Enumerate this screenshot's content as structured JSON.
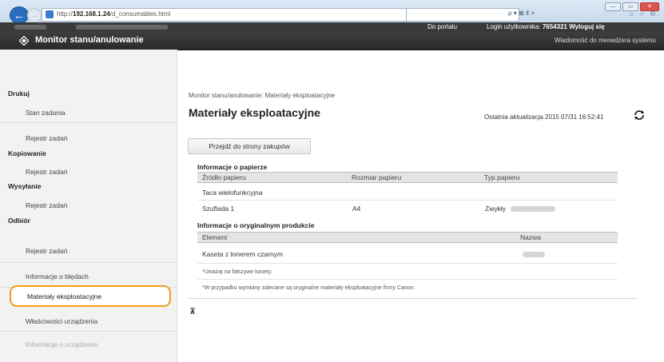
{
  "browser": {
    "url_prefix": "http://",
    "url_host": "192.168.1.24",
    "url_path": "/d_consumables.html",
    "search_placeholder": "",
    "search_tools": "ρ ▾ ⊠ ¢ ×",
    "window_buttons": [
      "—",
      "▭",
      "✕"
    ]
  },
  "topbar": {
    "portal_link": "Do portalu",
    "login_label": "Login użytkownika:",
    "login_value": "7654321",
    "logout_link": "Wyloguj się"
  },
  "header": {
    "title": "Monitor stanu/anulowanie",
    "admin_message": "Wiadomość do menedżera systemu"
  },
  "sidebar": {
    "sections": [
      {
        "heading": "Drukuj",
        "items": [
          "Stan zadania",
          "Rejestr zadań"
        ]
      },
      {
        "heading": "Kopiowanie",
        "items": [
          "Rejestr zadań"
        ]
      },
      {
        "heading": "Wysyłanie",
        "items": [
          "Rejestr zadań"
        ]
      },
      {
        "heading": "Odbiór",
        "items": [
          "Rejestr zadań"
        ]
      }
    ],
    "error_info": "Informacje o błędach",
    "consumables": "Materiały eksploatacyjne",
    "device_props": "Właściwości urządzenia",
    "device_info": "Informacje o urządzeniu"
  },
  "main": {
    "breadcrumb": "Monitor stanu/anulowanie: Materiały eksploatacyjne",
    "title": "Materiały eksploatacyjne",
    "last_update": "Ostatnia aktualizacja 2015 07/31 16:52:41",
    "buy_button": "Przejdź do strony zakupów",
    "paper": {
      "title": "Informacje o papierze",
      "columns": [
        "Źródło papieru",
        "Rozmiar papieru",
        "Typ papieru"
      ],
      "rows": [
        [
          "Taca wielofunkcyjna",
          "",
          ""
        ],
        [
          "Szuflada 1",
          "A4",
          "Zwykły"
        ]
      ]
    },
    "genuine": {
      "title": "Informacje o oryginalnym produkcie",
      "columns": [
        "Element",
        "Nazwa"
      ],
      "rows": [
        [
          "Kaseta z tonerem czarnym",
          ""
        ]
      ]
    },
    "notes": [
      "*Uważaj na fałszywe kasety.",
      "*W przypadku wymiany zalecane są oryginalne materiały eksploatacyjne firmy Canon."
    ]
  }
}
